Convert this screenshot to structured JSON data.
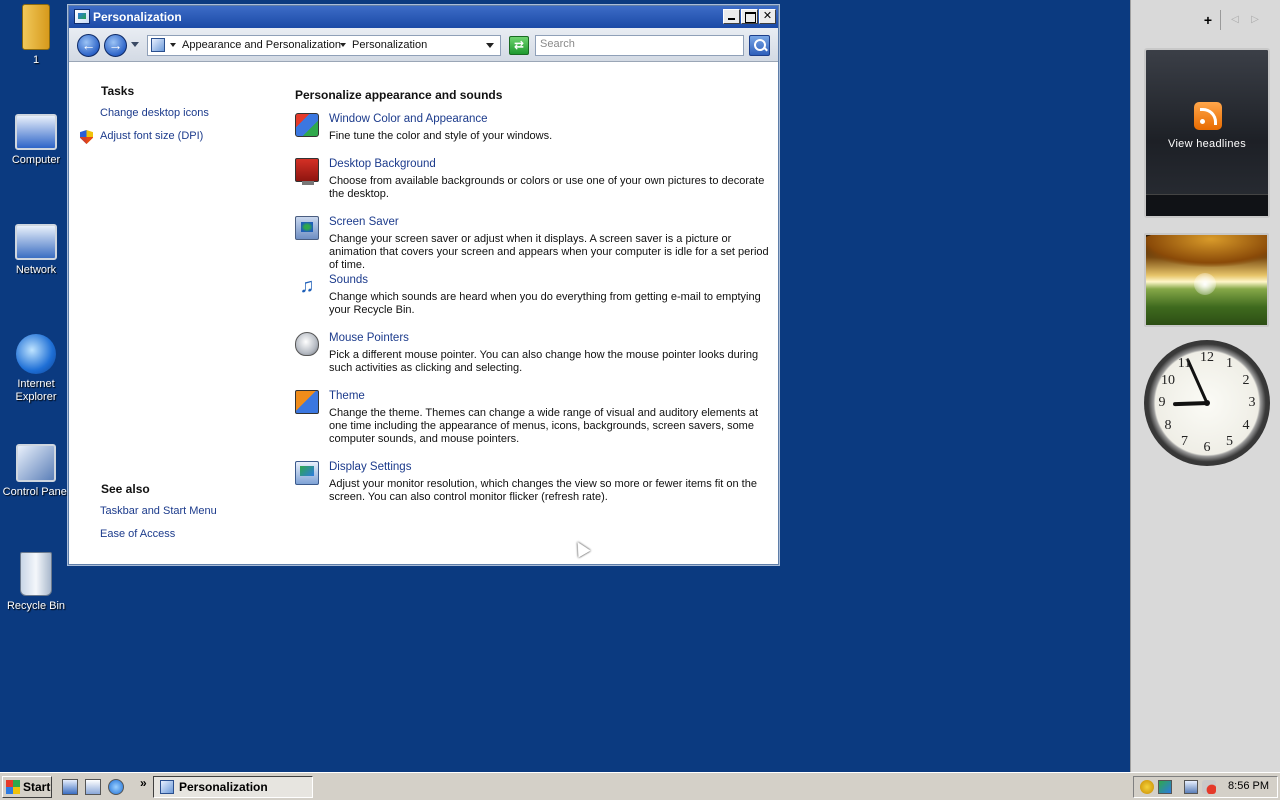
{
  "desktop": {
    "icons": [
      {
        "label": "1"
      },
      {
        "label": "Computer"
      },
      {
        "label": "Network"
      },
      {
        "label": "Internet Explorer"
      },
      {
        "label": "Control Panel"
      },
      {
        "label": "Recycle Bin"
      }
    ]
  },
  "sidebar": {
    "add_glyph": "+",
    "prev_glyph": "◁",
    "next_glyph": "▷",
    "feeds_text": "View headlines",
    "clock": {
      "hour": 8,
      "minute": 56,
      "numbers": [
        "12",
        "1",
        "2",
        "3",
        "4",
        "5",
        "6",
        "7",
        "8",
        "9",
        "10",
        "11"
      ]
    }
  },
  "window": {
    "title": "Personalization",
    "close_glyph": "✕",
    "back_glyph": "←",
    "forward_glyph": "→",
    "refresh_glyph": "⇄",
    "breadcrumb": [
      "Appearance and Personalization",
      "Personalization"
    ],
    "search_placeholder": "Search",
    "tasks": {
      "heading": "Tasks",
      "links": [
        "Change desktop icons",
        "Adjust font size (DPI)"
      ]
    },
    "see_also": {
      "heading": "See also",
      "links": [
        "Taskbar and Start Menu",
        "Ease of Access"
      ]
    },
    "main": {
      "heading": "Personalize appearance and sounds",
      "items": [
        {
          "title": "Window Color and Appearance",
          "desc": "Fine tune the color and style of your windows."
        },
        {
          "title": "Desktop Background",
          "desc": "Choose from available backgrounds or colors or use one of your own pictures to decorate the desktop."
        },
        {
          "title": "Screen Saver",
          "desc": "Change your screen saver or adjust when it displays. A screen saver is a picture or animation that covers your screen and appears when your computer is idle for a set period of time."
        },
        {
          "title": "Sounds",
          "desc": "Change which sounds are heard when you do everything from getting e-mail to emptying your Recycle Bin."
        },
        {
          "title": "Mouse Pointers",
          "desc": "Pick a different mouse pointer. You can also change how the mouse pointer looks during such activities as clicking and selecting."
        },
        {
          "title": "Theme",
          "desc": "Change the theme. Themes can change a wide range of visual and auditory elements at one time including the appearance of menus, icons, backgrounds, screen savers, some computer sounds, and mouse pointers."
        },
        {
          "title": "Display Settings",
          "desc": "Adjust your monitor resolution, which changes the view so more or fewer items fit on the screen. You can also control monitor flicker (refresh rate)."
        }
      ]
    }
  },
  "taskbar": {
    "start_label": "Start",
    "more_glyph": "»",
    "active_task": "Personalization",
    "time": "8:56 PM"
  }
}
